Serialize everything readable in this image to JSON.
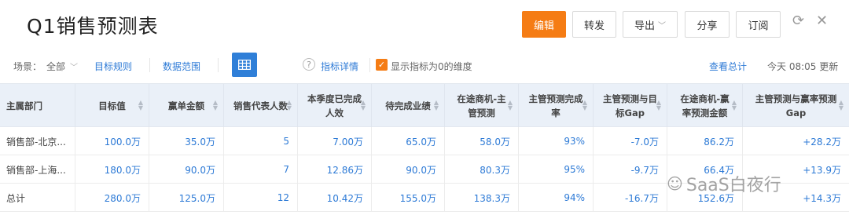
{
  "header": {
    "title": "Q1销售预测表",
    "buttons": {
      "edit": "编辑",
      "forward": "转发",
      "export": "导出",
      "share": "分享",
      "subscribe": "订阅"
    },
    "accent_color": "#f57c14"
  },
  "toolbar": {
    "scene_label": "场景：",
    "scene_value": "全部",
    "target_rules": "目标规则",
    "data_range": "数据范围",
    "indicator_detail": "指标详情",
    "show_zero_label": "显示指标为0的维度",
    "show_zero_checked": true,
    "view_total": "查看总计",
    "updated": "今天 08:05 更新"
  },
  "table": {
    "columns": [
      "主属部门",
      "目标值",
      "赢单金额",
      "销售代表人数",
      "本季度已完成人效",
      "待完成业绩",
      "在途商机-主管预测",
      "主管预测完成率",
      "主管预测与目标Gap",
      "在途商机-赢率预测金额",
      "主管预测与赢率预测Gap"
    ],
    "rows": [
      [
        "销售部-北京...",
        "100.0万",
        "35.0万",
        "5",
        "7.00万",
        "65.0万",
        "58.0万",
        "93%",
        "-7.0万",
        "86.2万",
        "+28.2万"
      ],
      [
        "销售部-上海...",
        "180.0万",
        "90.0万",
        "7",
        "12.86万",
        "90.0万",
        "80.3万",
        "95%",
        "-9.7万",
        "66.4万",
        "+13.9万"
      ],
      [
        "总计",
        "280.0万",
        "125.0万",
        "12",
        "10.42万",
        "155.0万",
        "138.3万",
        "94%",
        "-16.7万",
        "152.6万",
        "+14.3万"
      ]
    ]
  },
  "watermark": {
    "text": "SaaS白夜行",
    "icon": "wechat-icon"
  }
}
